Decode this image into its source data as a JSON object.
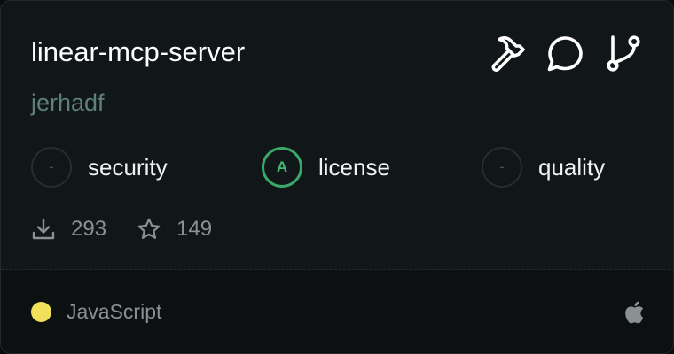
{
  "card": {
    "title": "linear-mcp-server",
    "author": "jerhadf"
  },
  "actions": [
    {
      "icon": "hammer-icon"
    },
    {
      "icon": "chat-bubble-icon"
    },
    {
      "icon": "git-fork-icon"
    }
  ],
  "scores": [
    {
      "badge": "-",
      "label": "security",
      "status": "none"
    },
    {
      "badge": "A",
      "label": "license",
      "status": "grade-a"
    },
    {
      "badge": "-",
      "label": "quality",
      "status": "none"
    }
  ],
  "stats": {
    "downloads": "293",
    "stars": "149"
  },
  "footer": {
    "language": "JavaScript",
    "language_color": "#f1e05a",
    "platform_icon": "apple-icon"
  },
  "colors": {
    "grade_a": "#3aa868",
    "author": "#5f7f7a",
    "muted": "#8a9192"
  }
}
